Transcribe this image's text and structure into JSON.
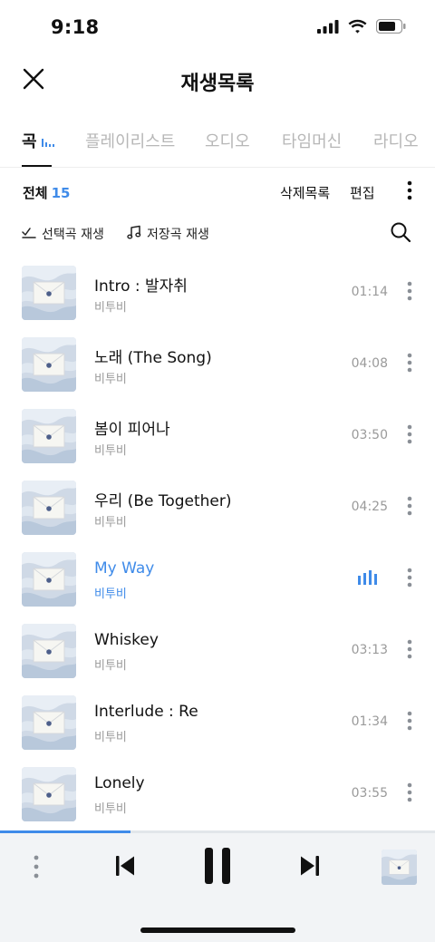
{
  "status_bar": {
    "time": "9:18"
  },
  "header": {
    "title": "재생목록"
  },
  "tabs": [
    {
      "label": "곡",
      "active": true
    },
    {
      "label": "플레이리스트",
      "active": false
    },
    {
      "label": "오디오",
      "active": false
    },
    {
      "label": "타임머신",
      "active": false
    },
    {
      "label": "라디오",
      "active": false
    }
  ],
  "toolbar": {
    "total_label": "전체",
    "total_count": "15",
    "delete_label": "삭제목록",
    "edit_label": "편집"
  },
  "actions": {
    "play_selected": "선택곡 재생",
    "play_saved": "저장곡 재생"
  },
  "songs": [
    {
      "title": "Intro : 발자취",
      "artist": "비투비",
      "duration": "01:14",
      "playing": false
    },
    {
      "title": "노래 (The Song)",
      "artist": "비투비",
      "duration": "04:08",
      "playing": false
    },
    {
      "title": "봄이 피어나",
      "artist": "비투비",
      "duration": "03:50",
      "playing": false
    },
    {
      "title": "우리 (Be Together)",
      "artist": "비투비",
      "duration": "04:25",
      "playing": false
    },
    {
      "title": "My Way",
      "artist": "비투비",
      "duration": "",
      "playing": true
    },
    {
      "title": "Whiskey",
      "artist": "비투비",
      "duration": "03:13",
      "playing": false
    },
    {
      "title": "Interlude : Re",
      "artist": "비투비",
      "duration": "01:34",
      "playing": false
    },
    {
      "title": "Lonely",
      "artist": "비투비",
      "duration": "03:55",
      "playing": false
    }
  ],
  "player": {
    "progress_fraction": 0.3,
    "state": "playing"
  },
  "icons": {
    "close": "close-icon",
    "more": "more-vertical-icon",
    "check_play": "check-play-icon",
    "music_note": "music-note-icon",
    "search": "search-icon",
    "equalizer": "equalizer-icon",
    "previous": "skip-previous-icon",
    "pause": "pause-icon",
    "next": "skip-next-icon"
  },
  "colors": {
    "accent": "#3f8be9",
    "text": "#111111",
    "muted": "#9a9a9a",
    "inactive_tab": "#b7b7b7",
    "player_bg": "#f2f4f6"
  }
}
